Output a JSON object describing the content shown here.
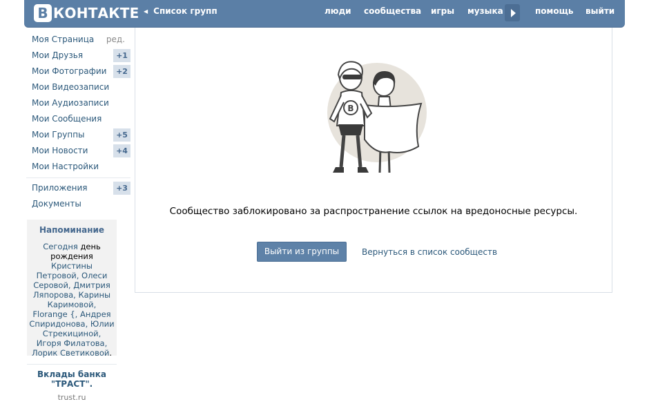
{
  "header": {
    "logo_letter": "В",
    "logo_text": "КОНТАКТЕ",
    "back_label": "Список групп",
    "nav": [
      "люди",
      "сообщества",
      "игры",
      "музыка",
      "помощь",
      "выйти"
    ],
    "more_icon": "triangle-right-icon",
    "colors": {
      "bar": "#5b7fa6",
      "more": "#4c6e94"
    }
  },
  "sidebar": {
    "items": [
      {
        "label": "Моя Страница",
        "edit": "ред."
      },
      {
        "label": "Мои Друзья",
        "count": "+1"
      },
      {
        "label": "Мои Фотографии",
        "count": "+2"
      },
      {
        "label": "Мои Видеозаписи"
      },
      {
        "label": "Мои Аудиозаписи"
      },
      {
        "label": "Мои Сообщения"
      },
      {
        "label": "Мои Группы",
        "count": "+5"
      },
      {
        "label": "Мои Новости",
        "count": "+4"
      },
      {
        "label": "Мои Настройки"
      },
      {
        "label": "Приложения",
        "count": "+3"
      },
      {
        "label": "Документы"
      }
    ]
  },
  "reminder": {
    "title": "Напоминание",
    "lines": [
      "Сегодня",
      "день",
      "рождения",
      "Кристины Петровой, Олеси Серовой, Дмитрия Ляпорова, Карины Каримовой, Florange {, Андрея Спиридонова, Юлии Стрекициной, Игоря Филатова, Лорик Светиковой",
      "."
    ]
  },
  "ad": {
    "title": "Вклады банка \"ТРАСТ\".",
    "url": "trust.ru"
  },
  "content": {
    "message": "Сообщество заблокировано за распространение ссылок на вредоносные ресурсы.",
    "leave_button": "Выйти из группы",
    "return_link": "Вернуться в список сообществ",
    "illustration_icon": "superhero-couple-icon"
  }
}
